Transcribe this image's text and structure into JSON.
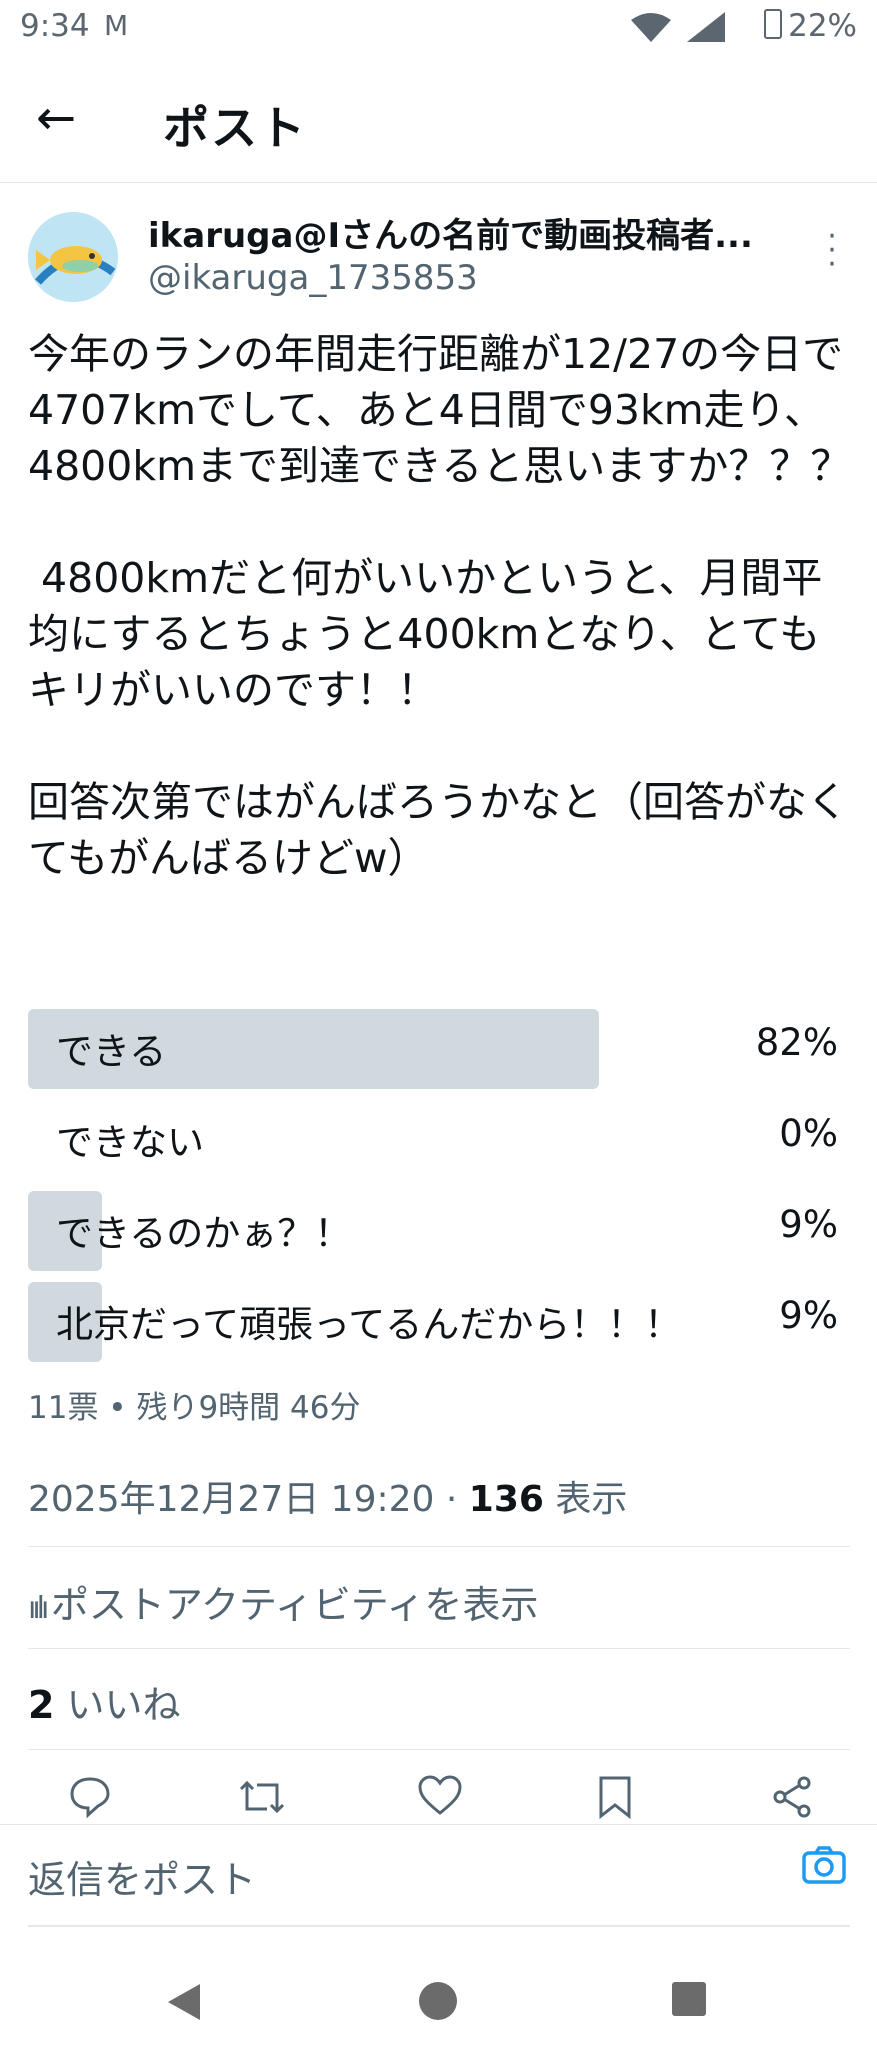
{
  "status": {
    "time": "9:34",
    "mail_icon": "M",
    "battery": "22%"
  },
  "header": {
    "title": "ポスト"
  },
  "author": {
    "name": "ikaruga@Iさんの名前で動画投稿者...",
    "handle": "@ikaruga_1735853"
  },
  "post": {
    "text": "今年のランの年間走行距離が12/27の今日で4707kmでして、あと4日間で93km走り、4800kmまで到達できると思いますか？？？\n\n 4800kmだと何がいいかというと、月間平均にするとちょうと400kmとなり、とてもキリがいいのです！！\n\n回答次第ではがんばろうかなと（回答がなくてもがんばるけどw）"
  },
  "poll": {
    "options": [
      {
        "label": "できる",
        "percent": "82%",
        "fraction": 0.82
      },
      {
        "label": "できない",
        "percent": "0%",
        "fraction": 0.0
      },
      {
        "label": "できるのかぁ？！",
        "percent": "9%",
        "fraction": 0.09
      },
      {
        "label": "北京だって頑張ってるんだから！！！",
        "percent": "9%",
        "fraction": 0.09
      }
    ],
    "meta": "11票 • 残り9時間 46分"
  },
  "timestamp": {
    "date": "2025年12月27日 19:20 · ",
    "views": "136",
    "views_label": " 表示"
  },
  "activity": {
    "label": "ポストアクティビティを表示"
  },
  "likes": {
    "count": "2",
    "label": " いいね"
  },
  "reply": {
    "placeholder": "返信をポスト"
  },
  "icons": [
    "back-arrow-icon",
    "more-icon",
    "reply-icon",
    "retweet-icon",
    "like-icon",
    "bookmark-icon",
    "share-icon",
    "camera-icon",
    "analytics-icon"
  ],
  "colors": {
    "accent": "#1d9bf0",
    "poll_bar": "#cfd9de",
    "secondary_text": "#536471"
  }
}
